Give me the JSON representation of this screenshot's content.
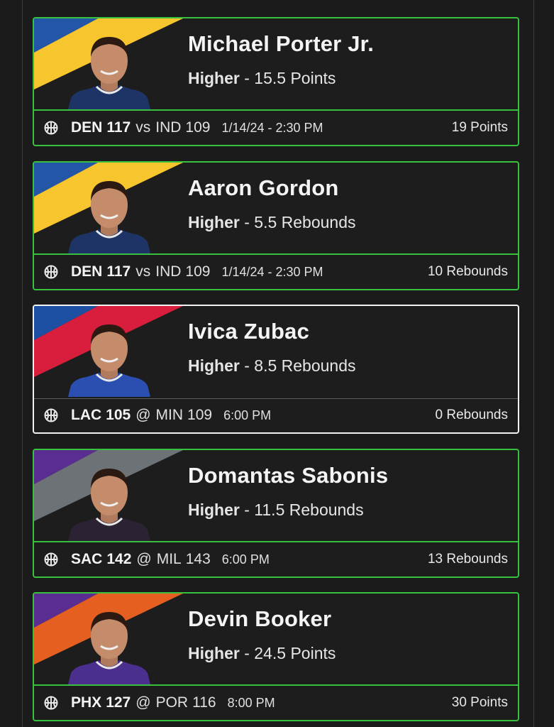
{
  "picks": [
    {
      "player": "Michael Porter Jr.",
      "direction": "Higher",
      "separator": "-",
      "line": "15.5 Points",
      "status": "hit",
      "team_colors": [
        "#2456a8",
        "#f7c62e"
      ],
      "jersey_color": "#1f3466",
      "headshot_icon": "player-headshot-icon",
      "sport_icon": "basketball-icon",
      "team": "DEN",
      "team_score": "117",
      "matchup_sep": "vs",
      "opponent": "IND",
      "opponent_score": "109",
      "time": "1/14/24 - 2:30 PM",
      "result": "19 Points"
    },
    {
      "player": "Aaron Gordon",
      "direction": "Higher",
      "separator": "-",
      "line": "5.5 Rebounds",
      "status": "hit",
      "team_colors": [
        "#2456a8",
        "#f7c62e"
      ],
      "jersey_color": "#1f3466",
      "headshot_icon": "player-headshot-icon",
      "sport_icon": "basketball-icon",
      "team": "DEN",
      "team_score": "117",
      "matchup_sep": "vs",
      "opponent": "IND",
      "opponent_score": "109",
      "time": "1/14/24 - 2:30 PM",
      "result": "10 Rebounds"
    },
    {
      "player": "Ivica Zubac",
      "direction": "Higher",
      "separator": "-",
      "line": "8.5 Rebounds",
      "status": "pending",
      "team_colors": [
        "#1d4fa3",
        "#d81e3c"
      ],
      "jersey_color": "#2a4fb0",
      "headshot_icon": "player-headshot-icon",
      "sport_icon": "basketball-icon",
      "team": "LAC",
      "team_score": "105",
      "matchup_sep": "@",
      "opponent": "MIN",
      "opponent_score": "109",
      "time": "6:00 PM",
      "result": "0 Rebounds"
    },
    {
      "player": "Domantas Sabonis",
      "direction": "Higher",
      "separator": "-",
      "line": "11.5 Rebounds",
      "status": "hit",
      "team_colors": [
        "#5a2d91",
        "#6d7277"
      ],
      "jersey_color": "#2b2233",
      "headshot_icon": "player-headshot-icon",
      "sport_icon": "basketball-icon",
      "team": "SAC",
      "team_score": "142",
      "matchup_sep": "@",
      "opponent": "MIL",
      "opponent_score": "143",
      "time": "6:00 PM",
      "result": "13 Rebounds"
    },
    {
      "player": "Devin Booker",
      "direction": "Higher",
      "separator": "-",
      "line": "24.5 Points",
      "status": "hit",
      "team_colors": [
        "#5a2d91",
        "#e56020"
      ],
      "jersey_color": "#4b2f8f",
      "headshot_icon": "player-headshot-icon",
      "sport_icon": "basketball-icon",
      "team": "PHX",
      "team_score": "127",
      "matchup_sep": "@",
      "opponent": "POR",
      "opponent_score": "116",
      "time": "8:00 PM",
      "result": "30 Points"
    }
  ],
  "colors": {
    "hit_border": "#38c13f",
    "pending_border": "#f2f2f2",
    "background": "#1b1b1b"
  }
}
